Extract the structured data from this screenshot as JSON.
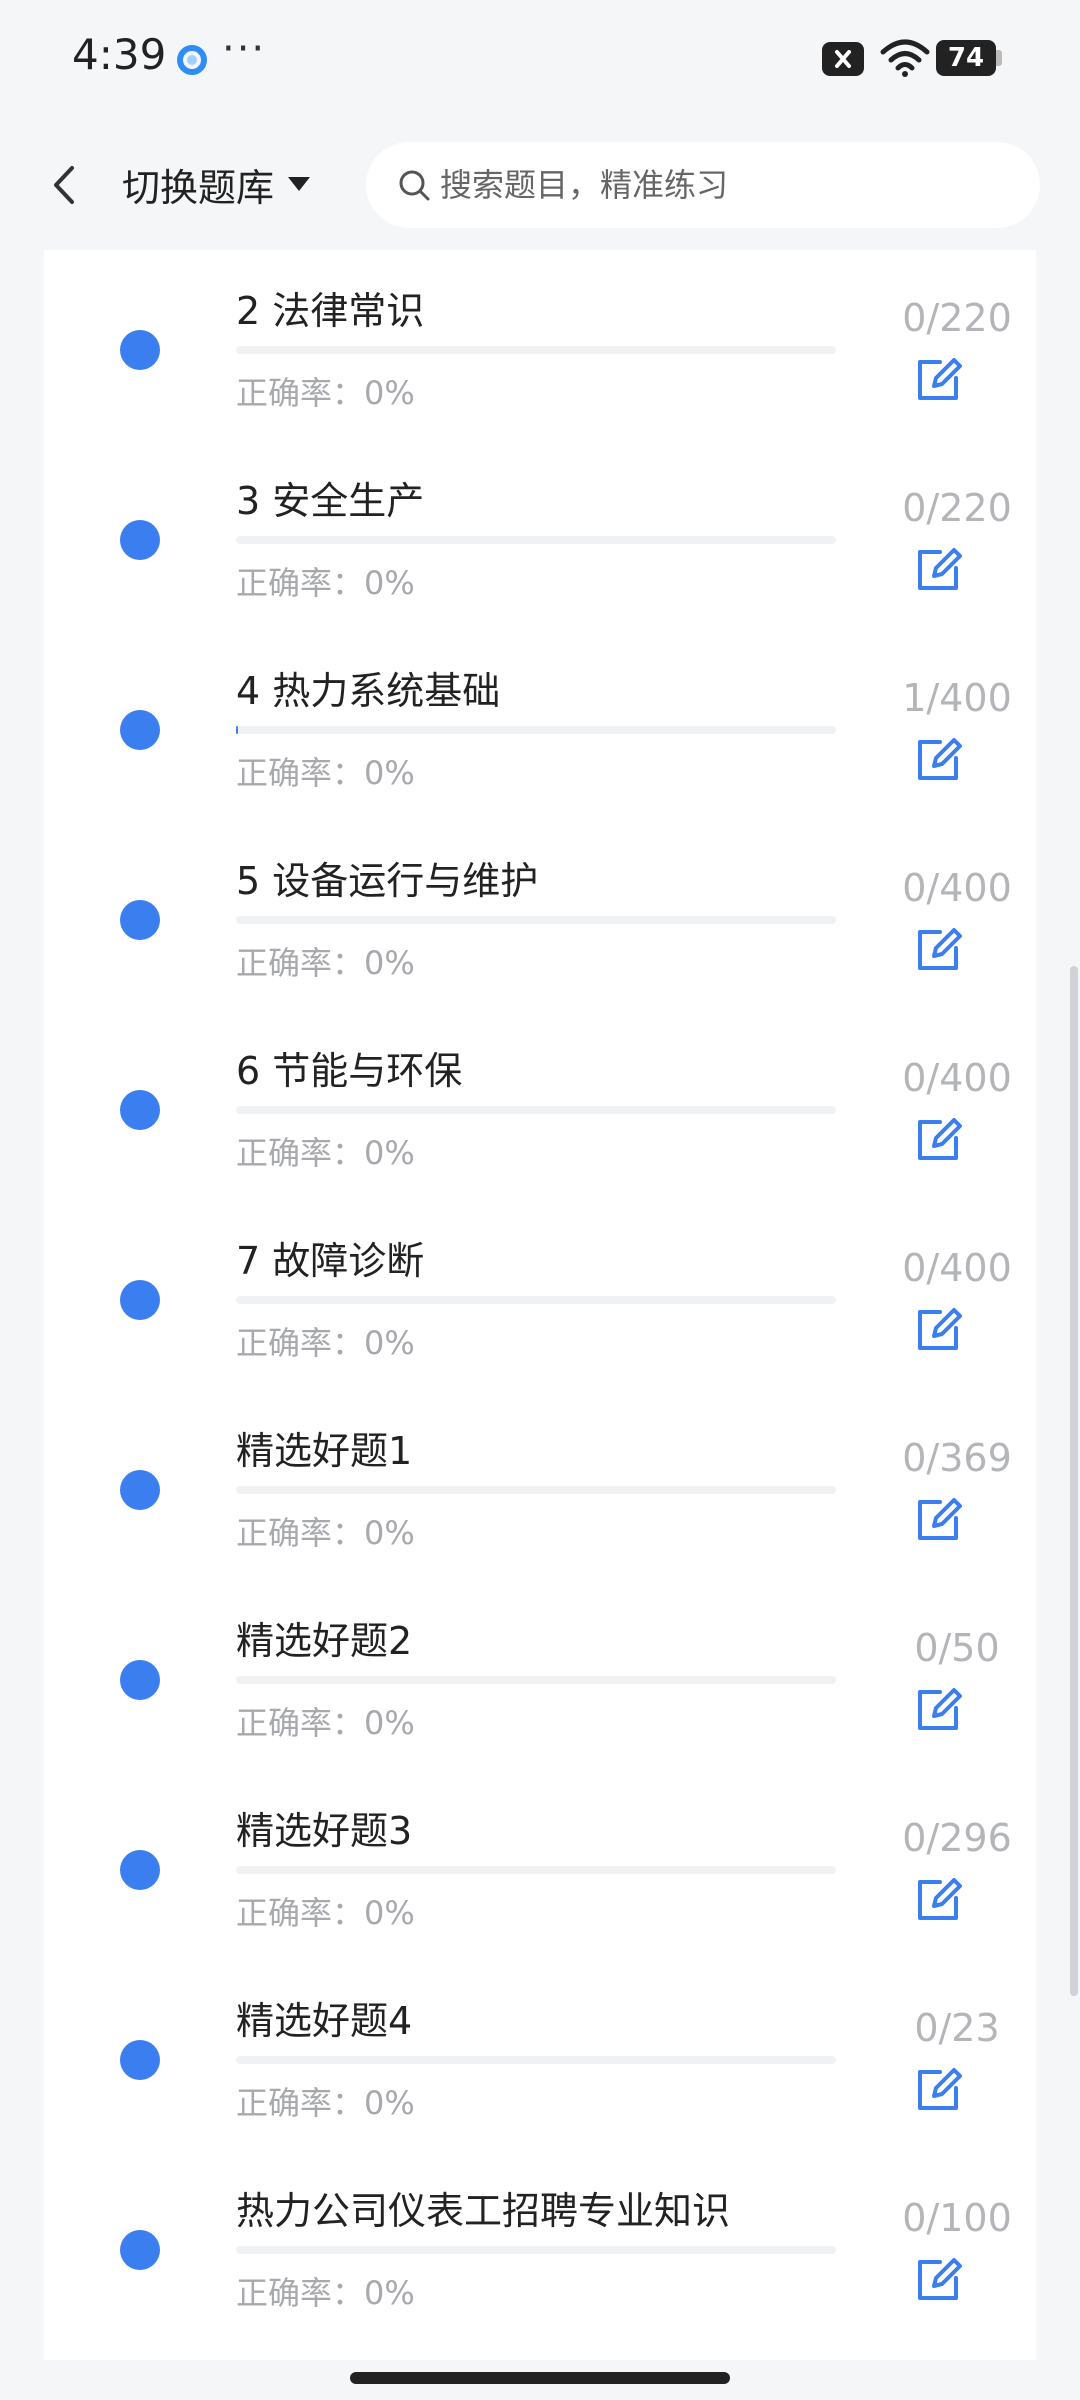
{
  "status_bar": {
    "time": "4:39",
    "dots": "···",
    "battery": "74"
  },
  "header": {
    "switch_label": "切换题库",
    "search_placeholder": "搜索题目，精准练习"
  },
  "accent_color": "#3a7ef0",
  "accuracy_prefix": "正确率：",
  "items": [
    {
      "title": "2 法律常识",
      "accuracy": "0%",
      "count": "0/220",
      "progress": 0.0
    },
    {
      "title": "3 安全生产",
      "accuracy": "0%",
      "count": "0/220",
      "progress": 0.0
    },
    {
      "title": "4 热力系统基础",
      "accuracy": "0%",
      "count": "1/400",
      "progress": 0.0025
    },
    {
      "title": "5 设备运行与维护",
      "accuracy": "0%",
      "count": "0/400",
      "progress": 0.0
    },
    {
      "title": "6 节能与环保",
      "accuracy": "0%",
      "count": "0/400",
      "progress": 0.0
    },
    {
      "title": "7 故障诊断",
      "accuracy": "0%",
      "count": "0/400",
      "progress": 0.0
    },
    {
      "title": "精选好题1",
      "accuracy": "0%",
      "count": "0/369",
      "progress": 0.0
    },
    {
      "title": "精选好题2",
      "accuracy": "0%",
      "count": "0/50",
      "progress": 0.0
    },
    {
      "title": "精选好题3",
      "accuracy": "0%",
      "count": "0/296",
      "progress": 0.0
    },
    {
      "title": "精选好题4",
      "accuracy": "0%",
      "count": "0/23",
      "progress": 0.0
    },
    {
      "title": "热力公司仪表工招聘专业知识",
      "accuracy": "0%",
      "count": "0/100",
      "progress": 0.0
    }
  ]
}
